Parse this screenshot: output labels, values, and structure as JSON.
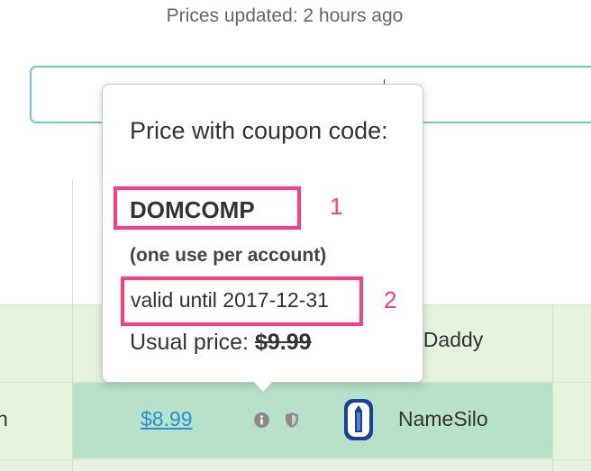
{
  "header": {
    "updated_text": "Prices updated: 2 hours ago"
  },
  "search": {
    "value": "",
    "placeholder": ""
  },
  "table": {
    "rows": [
      {
        "registrar_partial": "oDaddy"
      },
      {
        "tld_partial": "n",
        "price": "$8.99",
        "registrar": "NameSilo",
        "highlighted": true
      }
    ]
  },
  "popover": {
    "title": "Price with coupon code:",
    "coupon_code": "DOMCOMP",
    "usage_note": "(one use per account)",
    "valid_until": "valid until 2017-12-31",
    "usual_label": "Usual price:",
    "usual_price": "$9.99"
  },
  "annotations": {
    "label_1": "1",
    "label_2": "2",
    "color": "#ff3d7f"
  },
  "colors": {
    "accent": "#6ec1ea",
    "link": "#2a8fd3",
    "row_bg": "#e6f3dc",
    "row_highlight": "#b7e1c8"
  },
  "icons": [
    "info-icon",
    "shield-icon",
    "namesilo-logo-icon"
  ]
}
